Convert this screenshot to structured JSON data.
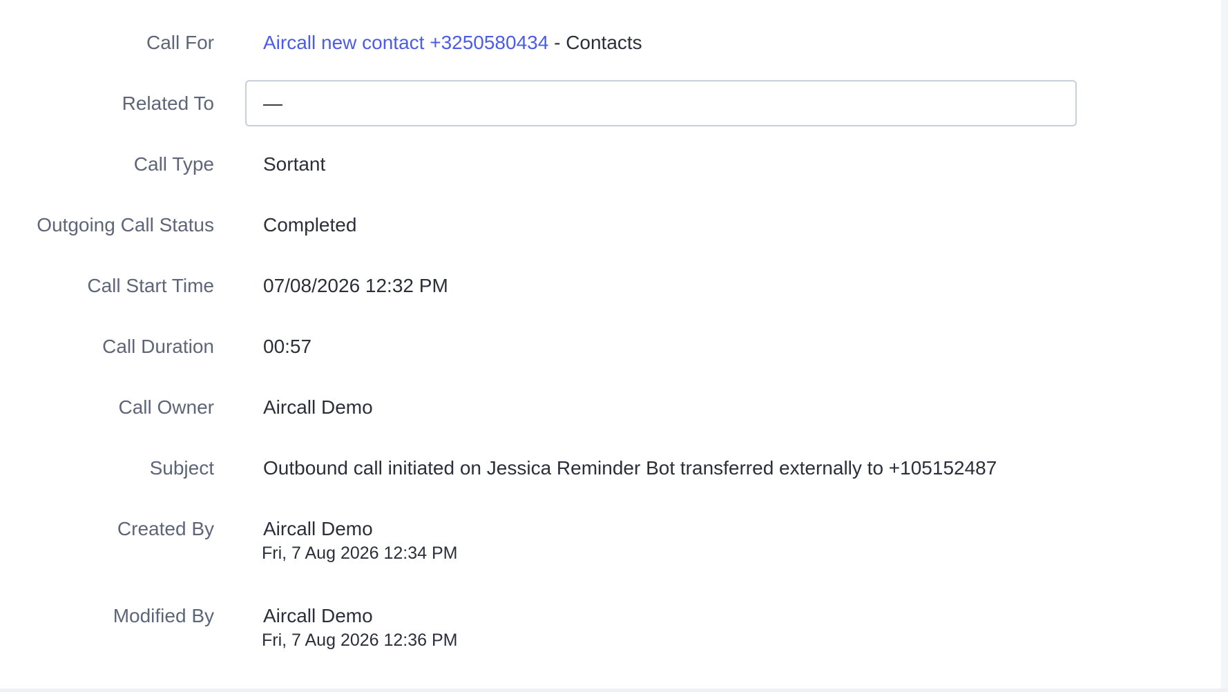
{
  "fields": {
    "call_for": {
      "label": "Call For",
      "link": "Aircall new contact +3250580434",
      "separator": " - ",
      "module": "Contacts"
    },
    "related_to": {
      "label": "Related To",
      "value": "—"
    },
    "call_type": {
      "label": "Call Type",
      "value": "Sortant"
    },
    "outgoing_call_status": {
      "label": "Outgoing Call Status",
      "value": "Completed"
    },
    "call_start_time": {
      "label": "Call Start Time",
      "value": "07/08/2026 12:32 PM"
    },
    "call_duration": {
      "label": "Call Duration",
      "value": "00:57"
    },
    "call_owner": {
      "label": "Call Owner",
      "value": "Aircall Demo"
    },
    "subject": {
      "label": "Subject",
      "value": "Outbound call initiated on Jessica Reminder Bot transferred externally to +105152487"
    },
    "created_by": {
      "label": "Created By",
      "name": "Aircall Demo",
      "timestamp": "Fri, 7 Aug 2026 12:34 PM"
    },
    "modified_by": {
      "label": "Modified By",
      "name": "Aircall Demo",
      "timestamp": "Fri, 7 Aug 2026 12:36 PM"
    }
  }
}
